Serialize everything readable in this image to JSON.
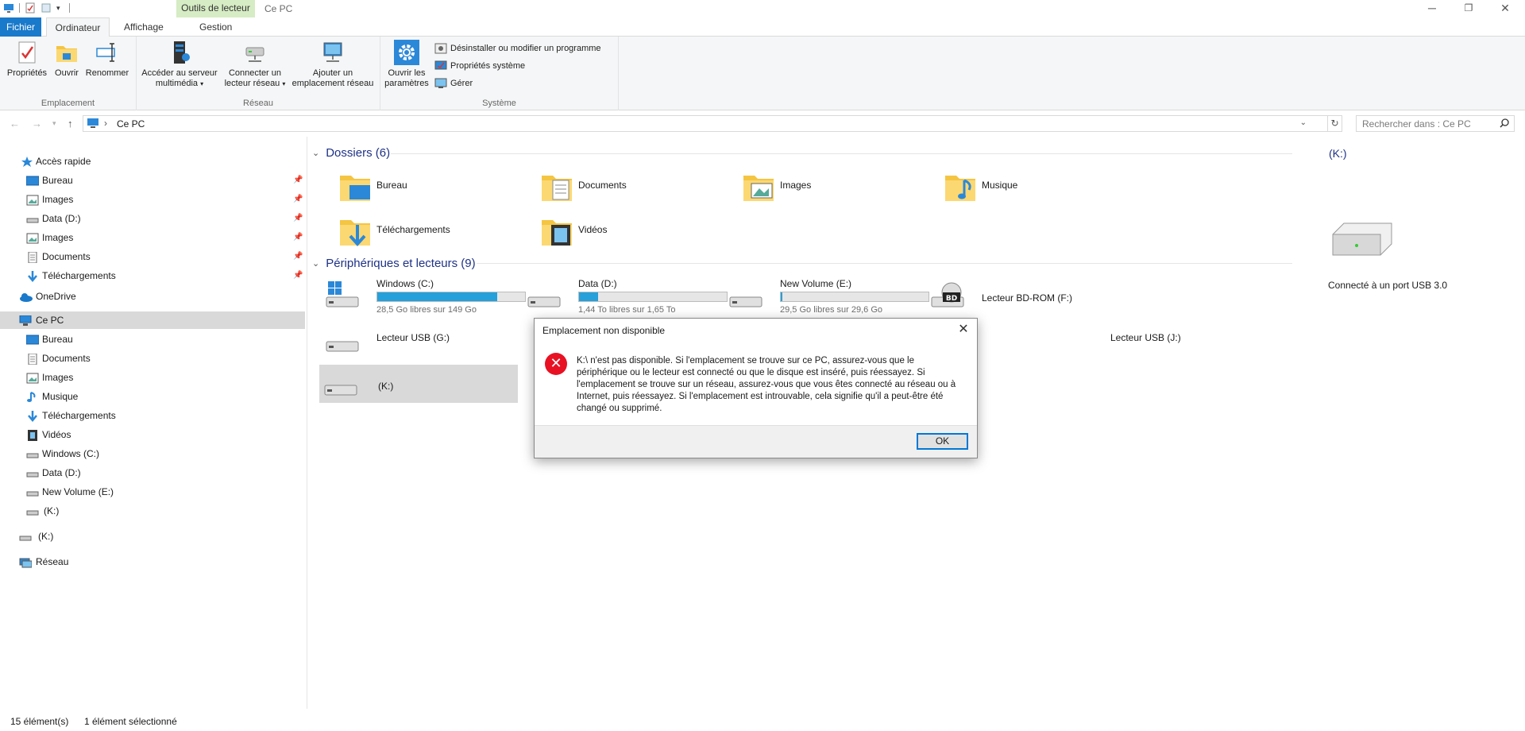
{
  "window": {
    "tools_context": "Outils de lecteur",
    "title": "Ce PC"
  },
  "ribbon_tabs": {
    "file": "Fichier",
    "computer": "Ordinateur",
    "view": "Affichage",
    "manage": "Gestion"
  },
  "ribbon": {
    "emplacement_group": "Emplacement",
    "reseau_group": "Réseau",
    "systeme_group": "Système",
    "properties": "Propriétés",
    "open": "Ouvrir",
    "rename": "Renommer",
    "media_server_l1": "Accéder au serveur",
    "media_server_l2": "multimédia",
    "map_drive_l1": "Connecter un",
    "map_drive_l2": "lecteur réseau",
    "add_location_l1": "Ajouter un",
    "add_location_l2": "emplacement réseau",
    "open_settings_l1": "Ouvrir les",
    "open_settings_l2": "paramètres",
    "uninstall": "Désinstaller ou modifier un programme",
    "sys_props": "Propriétés système",
    "manage": "Gérer"
  },
  "address": {
    "path": "Ce PC",
    "search_placeholder": "Rechercher dans : Ce PC"
  },
  "nav": {
    "quick_access": "Accès rapide",
    "qa_items": [
      "Bureau",
      "Images",
      "Data (D:)",
      "Images",
      "Documents",
      "Téléchargements"
    ],
    "onedrive": "OneDrive",
    "this_pc": "Ce PC",
    "pc_items": [
      "Bureau",
      "Documents",
      "Images",
      "Musique",
      "Téléchargements",
      "Vidéos",
      "Windows (C:)",
      "Data (D:)",
      "New Volume (E:)",
      "(K:)"
    ],
    "k_drive": "(K:)",
    "network": "Réseau"
  },
  "content": {
    "folders_header": "Dossiers (6)",
    "folders": [
      "Bureau",
      "Documents",
      "Images",
      "Musique",
      "Téléchargements",
      "Vidéos"
    ],
    "devices_header": "Périphériques et lecteurs (9)",
    "drives": [
      {
        "name": "Windows (C:)",
        "free": "28,5 Go libres sur 149 Go",
        "used_fraction": 0.81
      },
      {
        "name": "Data (D:)",
        "free": "1,44 To libres sur 1,65 To",
        "used_fraction": 0.13
      },
      {
        "name": "New Volume (E:)",
        "free": "29,5 Go libres sur 29,6 Go",
        "used_fraction": 0.01
      },
      {
        "name": "Lecteur BD-ROM (F:)"
      },
      {
        "name": "Lecteur USB (G:)"
      },
      {
        "name": "Lecteur USB (J:)"
      },
      {
        "name": "(K:)"
      }
    ]
  },
  "details": {
    "title": "(K:)",
    "description": "Connecté à un port USB 3.0"
  },
  "status": {
    "count": "15 élément(s)",
    "selected": "1 élément sélectionné"
  },
  "dialog": {
    "title": "Emplacement non disponible",
    "message_l1": "K:\\ n'est pas disponible. Si l'emplacement se trouve sur ce PC, assurez-vous que le",
    "message_l2": "périphérique ou le lecteur est connecté ou que le disque est inséré, puis réessayez. Si",
    "message_l3": "l'emplacement se trouve sur un réseau, assurez-vous que vous êtes connecté au réseau ou à",
    "message_l4": "Internet, puis réessayez. Si l'emplacement est introuvable, cela signifie qu'il a peut-être été",
    "message_l5": "changé ou supprimé.",
    "ok_label": "OK"
  },
  "colors": {
    "accent": "#1979ca",
    "drive_bar": "#26a0da",
    "error": "#e81123",
    "section_title": "#1e3287"
  }
}
